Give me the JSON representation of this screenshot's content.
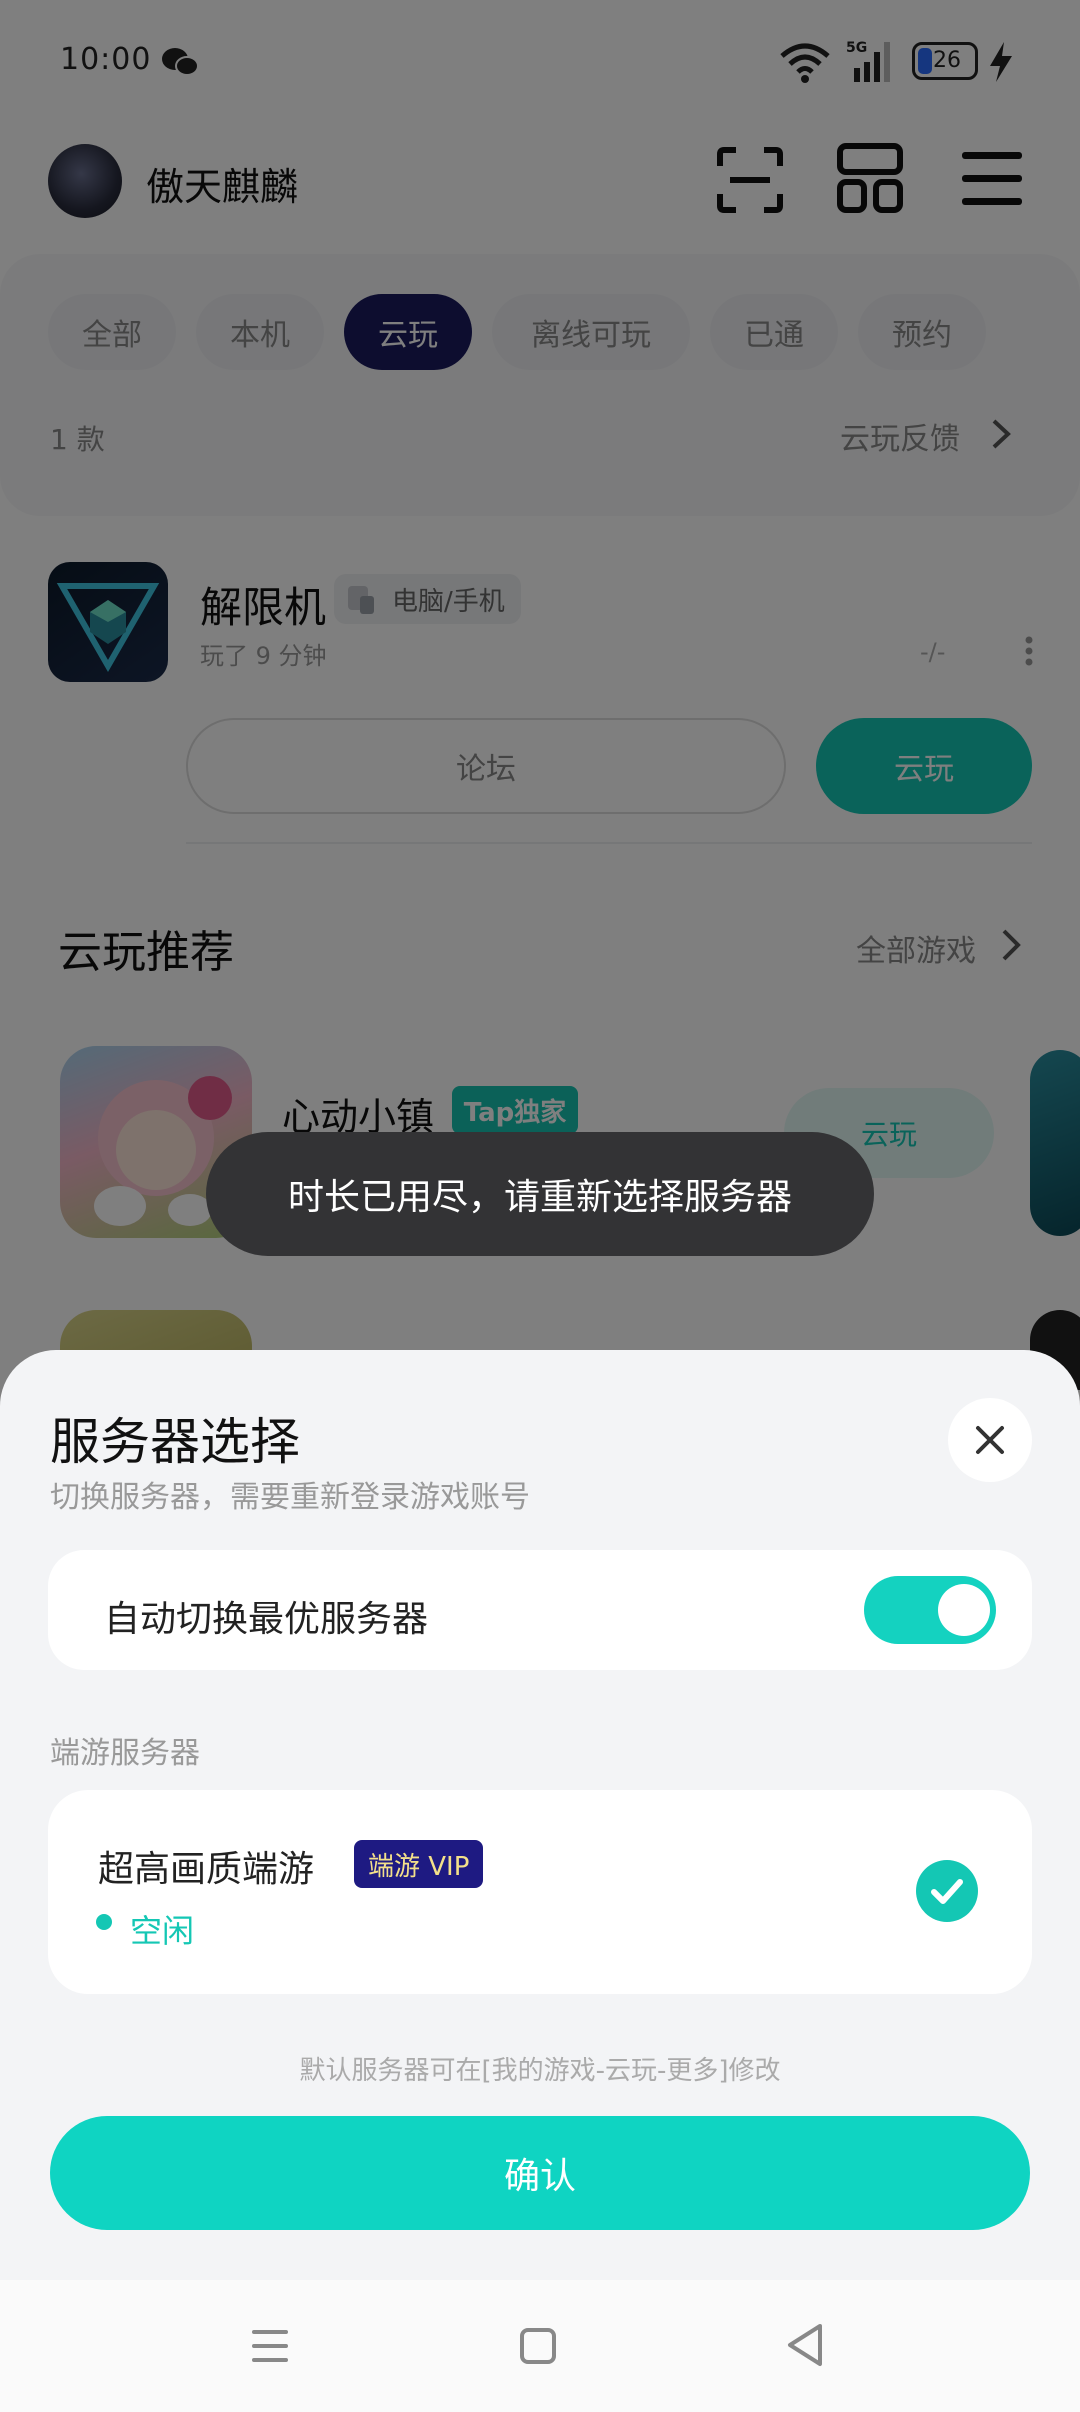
{
  "status_bar": {
    "time": "10:00",
    "battery": "26",
    "network": "5G"
  },
  "header": {
    "username": "傲天麒麟"
  },
  "filters": {
    "chips": [
      "全部",
      "本机",
      "云玩",
      "离线可玩",
      "已通",
      "预约"
    ],
    "active_index": 2,
    "count_text": "1 款",
    "feedback_label": "云玩反馈"
  },
  "game": {
    "name": "解限机",
    "platform_tag": "电脑/手机",
    "played_text": "玩了 9 分钟",
    "dash": "-/-",
    "forum_label": "论坛",
    "cloud_play_label": "云玩"
  },
  "recommend": {
    "title": "云玩推荐",
    "all_games_label": "全部游戏",
    "items": [
      {
        "name": "心动小镇",
        "badge": "Tap独家",
        "play_label": "云玩"
      }
    ]
  },
  "toast": {
    "text": "时长已用尽，请重新选择服务器"
  },
  "sheet": {
    "title": "服务器选择",
    "subtitle": "切换服务器，需要重新登录游戏账号",
    "auto_switch_label": "自动切换最优服务器",
    "auto_switch_on": true,
    "section_label": "端游服务器",
    "server": {
      "name": "超高画质端游",
      "badge": "端游 VIP",
      "status": "空闲",
      "selected": true
    },
    "hint": "默认服务器可在[我的游戏-云玩-更多]修改",
    "confirm_label": "确认"
  },
  "colors": {
    "accent": "#14c7b4",
    "chip_active": "#1a1a5e",
    "vip_badge": "#1e1a82",
    "confirm": "#0fd4c2"
  }
}
